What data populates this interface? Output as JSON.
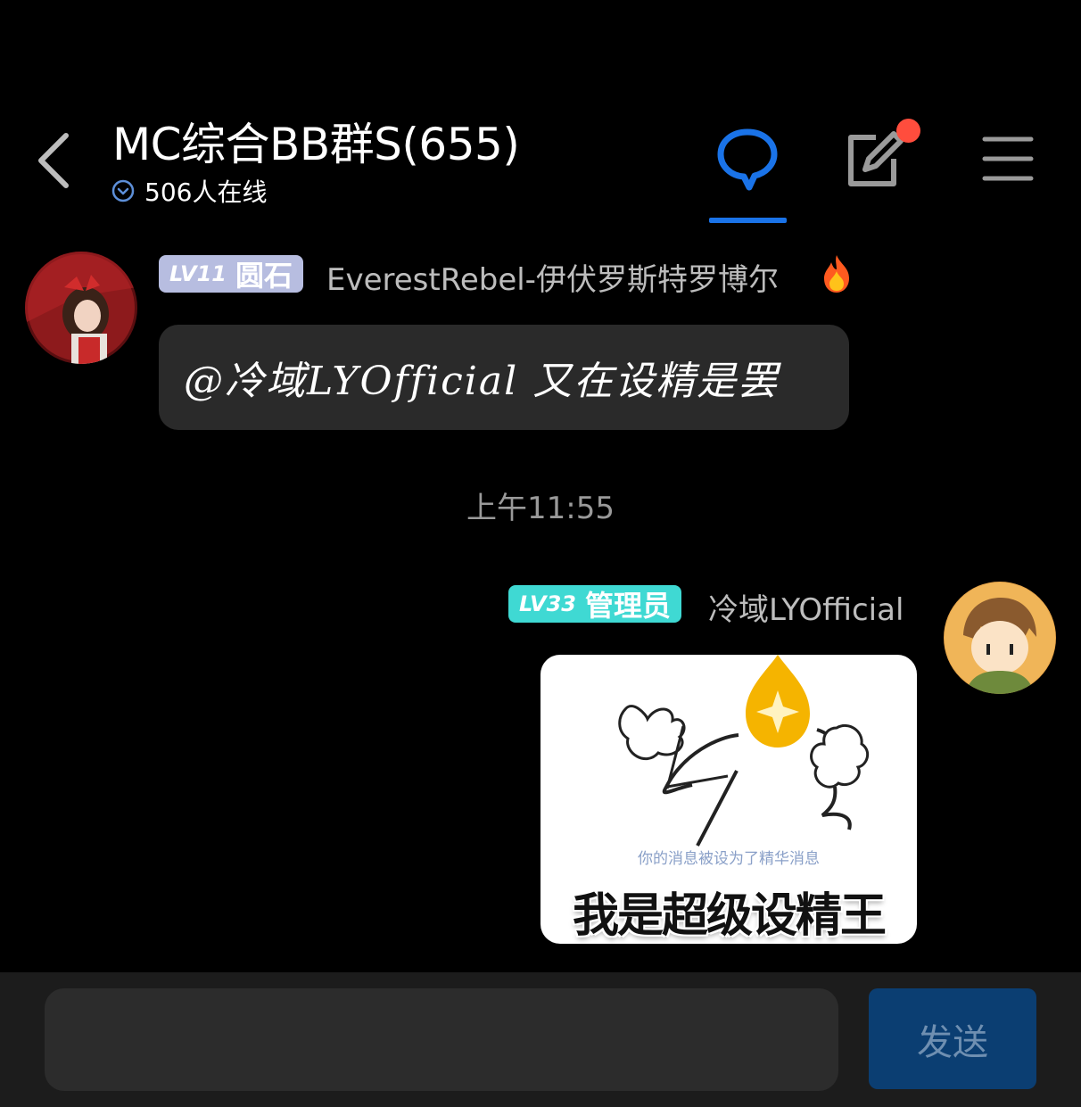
{
  "header": {
    "title": "MC综合BB群S(655)",
    "online_count": "506人在线",
    "icons": [
      "back-arrow-icon",
      "chat-bubble-icon",
      "edit-icon",
      "menu-icon"
    ],
    "accent_color": "#1a73e8",
    "notification_dot_color": "#ff4d3d"
  },
  "messages": [
    {
      "side": "left",
      "badge": {
        "level": "LV11",
        "title": "圆石",
        "color": "#b7bde0"
      },
      "sender": "EverestRebel-伊伏罗斯特罗博尔",
      "sender_icon": "fire-icon",
      "text": "@冷域LYOfficial 又在设精是罢"
    },
    {
      "side": "right",
      "badge": {
        "level": "LV33",
        "title": "管理员",
        "color": "#3fd9d3"
      },
      "sender": "冷域LYOfficial",
      "sticker": {
        "caption": "你的消息被设为了精华消息",
        "title": "我是超级设精王"
      }
    }
  ],
  "timestamp": "上午11:55",
  "composer": {
    "placeholder": "",
    "send_label": "发送",
    "send_color": "#0b3e72"
  }
}
